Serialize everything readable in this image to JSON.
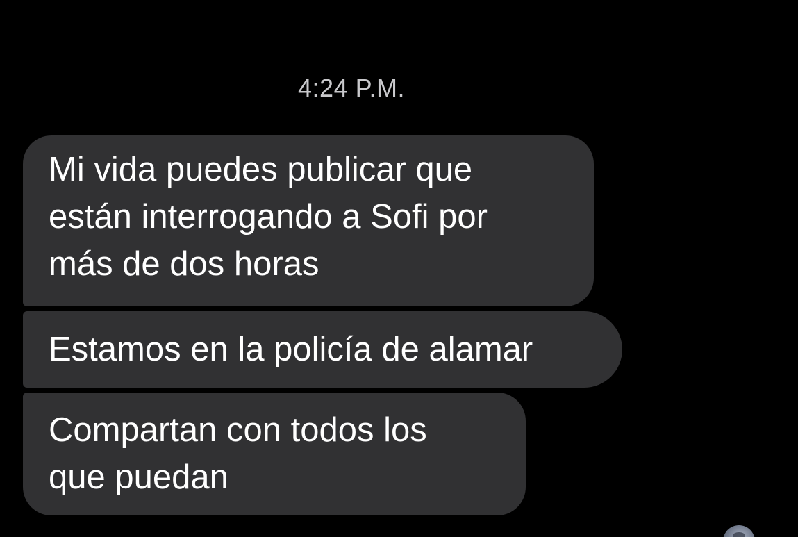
{
  "conversation": {
    "timestamp": "4:24 P.M.",
    "messages": [
      {
        "lines": [
          "Mi vida puedes publicar que",
          "están interrogando a Sofi por",
          "más de dos horas"
        ]
      },
      {
        "lines": [
          "Estamos en la policía de alamar"
        ]
      },
      {
        "lines": [
          "Compartan con todos los",
          "que puedan"
        ]
      }
    ]
  },
  "colors": {
    "background": "#000000",
    "bubble": "#313133",
    "message_text": "#ffffff",
    "timestamp_text": "#c9c9cc"
  }
}
